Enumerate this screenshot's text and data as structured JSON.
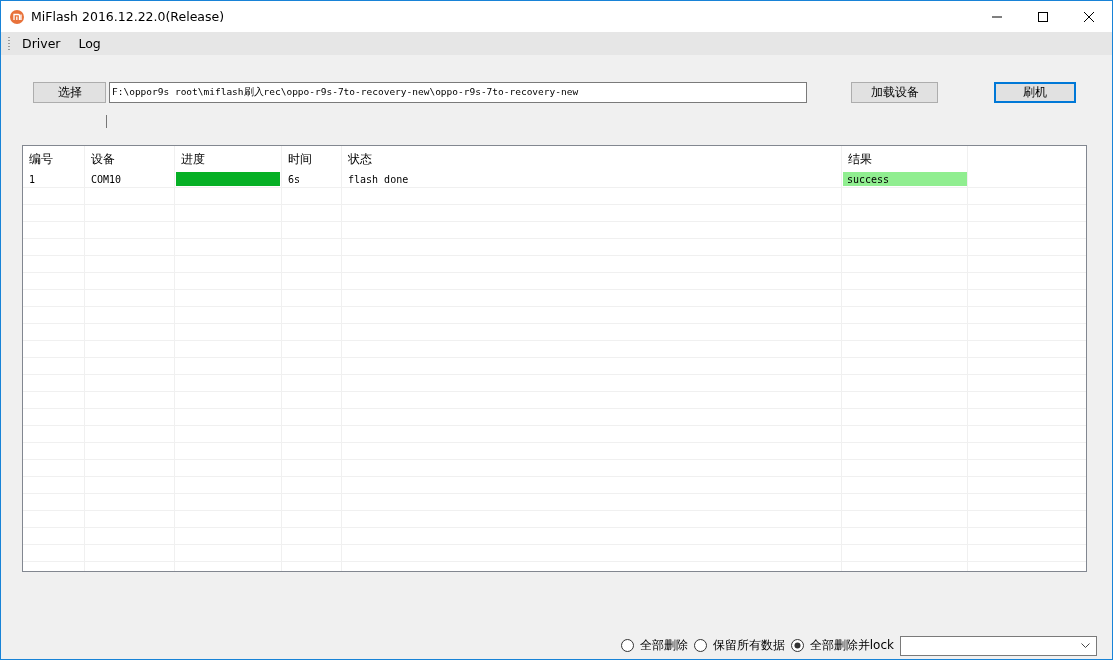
{
  "window": {
    "title": "MiFlash 2016.12.22.0(Release)"
  },
  "menu": [
    "Driver",
    "Log"
  ],
  "toolbar": {
    "select_button": "选择",
    "path": "F:\\oppor9s root\\miflash刷入rec\\oppo-r9s-7to-recovery-new\\oppo-r9s-7to-recovery-new",
    "load_button": "加载设备",
    "flash_button": "刷机"
  },
  "table": {
    "columns": [
      "编号",
      "设备",
      "进度",
      "时间",
      "状态",
      "结果"
    ],
    "rows": [
      {
        "number": "1",
        "device": "COM10",
        "level": 1,
        "time": "6s",
        "status": "flash done",
        "result": "success",
        "color": "#90ee90"
      }
    ]
  },
  "options": [
    {
      "label": "全部删除",
      "selected": false
    },
    {
      "label": "保留所有数据",
      "selected": false
    },
    {
      "label": "全部删除并lock",
      "selected": true
    }
  ]
}
